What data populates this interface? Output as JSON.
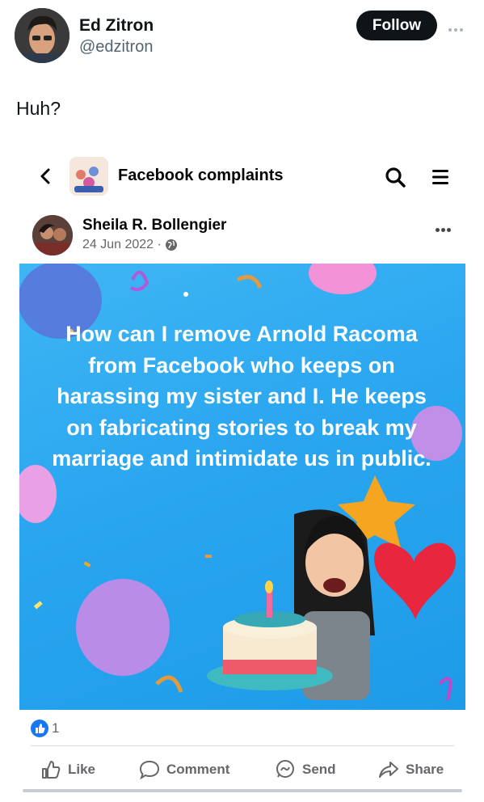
{
  "tweet": {
    "author_name": "Ed Zitron",
    "author_handle": "@edzitron",
    "follow_label": "Follow",
    "text": "Huh?"
  },
  "fb": {
    "group_title": "Facebook complaints",
    "poster_name": "Sheila R. Bollengier",
    "post_date": "24 Jun 2022 ·",
    "image_text": "How can I remove Arnold Racoma from Facebook who keeps on harassing my sister and I. He keeps on fabricating stories to break my marriage and intimidate us in public.",
    "like_count": "1",
    "actions": {
      "like": "Like",
      "comment": "Comment",
      "send": "Send",
      "share": "Share"
    }
  },
  "colors": {
    "follow_button": "#0f1419",
    "fb_blue": "#1877f2",
    "image_background": "#2aa6f0",
    "muted_text": "#65676b"
  },
  "icons": [
    "more-icon",
    "back-icon",
    "search-icon",
    "menu-icon",
    "globe-icon",
    "like-icon",
    "comment-icon",
    "send-icon",
    "share-icon"
  ]
}
